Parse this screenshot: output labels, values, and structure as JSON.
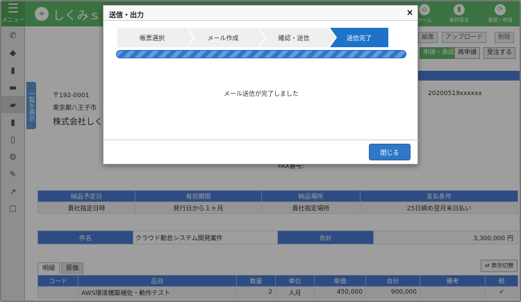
{
  "topbar": {
    "menu_label": "メニュー",
    "logo": "しくみｓ",
    "buttons": [
      {
        "label": "ホーム",
        "icon": "home-icon",
        "glyph": "⌂"
      },
      {
        "label": "案件収支",
        "icon": "chart-icon",
        "glyph": "▮"
      },
      {
        "label": "承認・申請",
        "icon": "refresh-icon",
        "glyph": "⟳"
      }
    ]
  },
  "toolbar": {
    "edit": "編集",
    "upload": "アップロード",
    "delete": "削除",
    "apply": "申請・承認",
    "reapply": "再申請",
    "order": "受注する"
  },
  "list_tab": "一覧を表示",
  "document": {
    "postal": "〒192-0001",
    "address": "東京都八王子市",
    "company": "株式会社しくみ",
    "doc_no": "20200519xxxxxx",
    "fax": "FAX番号:"
  },
  "delivery_table": {
    "headers": [
      "納品予定日",
      "有効期限",
      "納品場所",
      "支払条件"
    ],
    "values": [
      "貴社指定日時",
      "発行日から１ヶ月",
      "貴社指定場所",
      "25日締め翌月末日払い"
    ]
  },
  "subject_table": {
    "subject_label": "件名",
    "subject_value": "クラウド勤怠システム開発案件",
    "total_label": "合計",
    "total_value": "3,300,000 円"
  },
  "tabs": [
    "明細",
    "原価"
  ],
  "switch_label": "表示切替",
  "items_table": {
    "headers": [
      "コード",
      "品目",
      "数量",
      "単位",
      "単価",
      "合計",
      "備考",
      "税"
    ],
    "rows": [
      [
        "",
        "AWS環境構築補佐・動作テスト",
        "2",
        "人月",
        "450,000",
        "900,000",
        "",
        "✔"
      ]
    ]
  },
  "modal": {
    "title": "送信・出力",
    "close_x": "×",
    "steps": [
      "帳票選択",
      "メール作成",
      "確認・送信",
      "送信完了"
    ],
    "active_step": 3,
    "progress": 1.0,
    "message": "メール送信が完了しました",
    "close_button": "閉じる"
  },
  "colors": {
    "brand_green": "#5fb96a",
    "accent_blue": "#1e73c9",
    "header_blue": "#4a7bd4"
  }
}
